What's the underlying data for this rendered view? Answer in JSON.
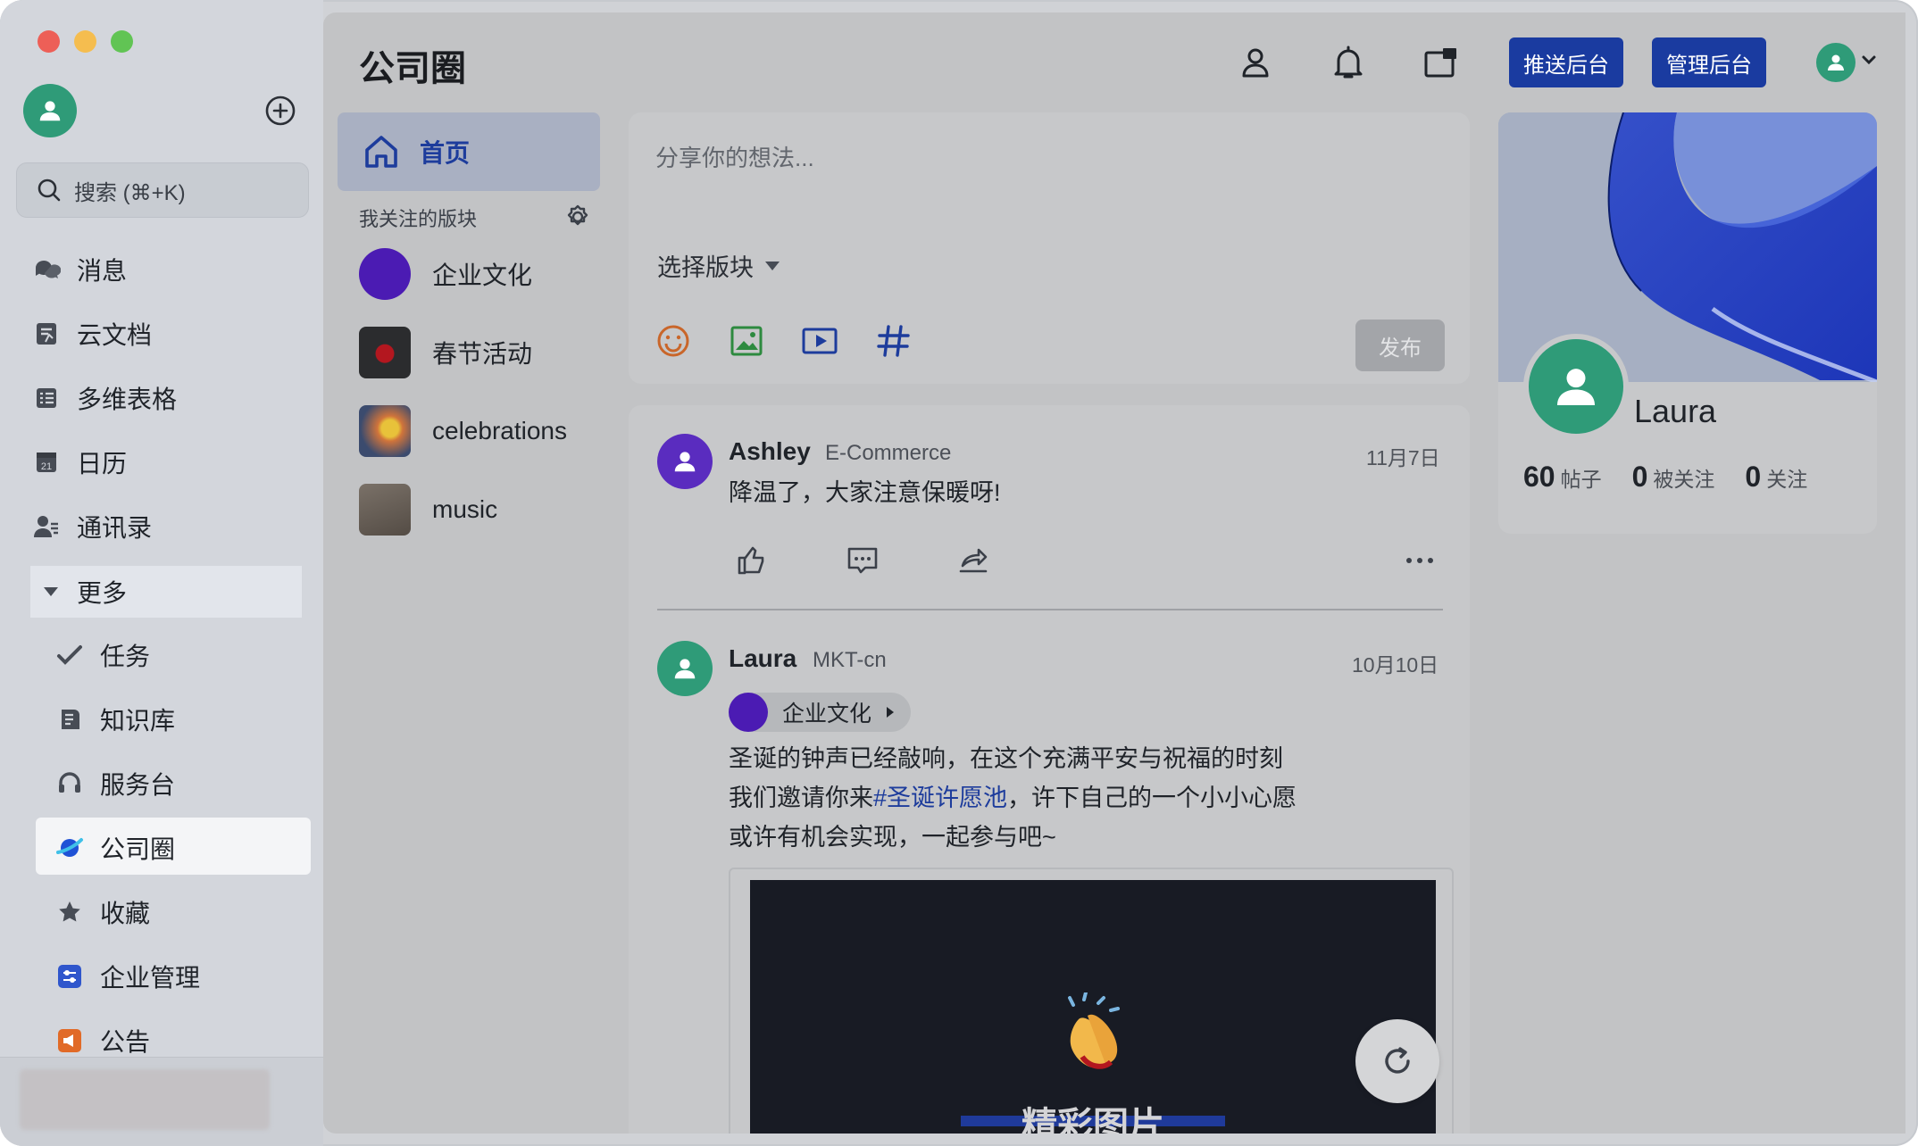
{
  "app": {
    "page_title": "公司圈"
  },
  "sidebar": {
    "search_placeholder": "搜索 (⌘+K)",
    "items": [
      {
        "label": "消息",
        "icon": "chat-bubbles-icon"
      },
      {
        "label": "云文档",
        "icon": "document-icon"
      },
      {
        "label": "多维表格",
        "icon": "table-icon"
      },
      {
        "label": "日历",
        "icon": "calendar-icon"
      },
      {
        "label": "通讯录",
        "icon": "contacts-icon"
      }
    ],
    "more_label": "更多",
    "sub_items": [
      {
        "label": "任务",
        "icon": "task-check-icon"
      },
      {
        "label": "知识库",
        "icon": "wiki-icon"
      },
      {
        "label": "服务台",
        "icon": "headset-icon"
      },
      {
        "label": "公司圈",
        "icon": "planet-icon"
      },
      {
        "label": "收藏",
        "icon": "star-icon"
      },
      {
        "label": "企业管理",
        "icon": "admin-sliders-icon"
      },
      {
        "label": "公告",
        "icon": "megaphone-icon"
      }
    ],
    "calendar_day": "21"
  },
  "header": {
    "push_button": "推送后台",
    "admin_button": "管理后台"
  },
  "boards": {
    "home_label": "首页",
    "followed_label": "我关注的版块",
    "items": [
      {
        "label": "企业文化"
      },
      {
        "label": "春节活动"
      },
      {
        "label": "celebrations"
      },
      {
        "label": "music"
      }
    ]
  },
  "composer": {
    "placeholder": "分享你的想法...",
    "select_label": "选择版块",
    "publish_label": "发布"
  },
  "posts": [
    {
      "author": "Ashley",
      "dept": "E-Commerce",
      "date": "11月7日",
      "text": "降温了，大家注意保暖呀!"
    },
    {
      "author": "Laura",
      "dept": "MKT-cn",
      "date": "10月10日",
      "board": "企业文化",
      "line1": "圣诞的钟声已经敲响，在这个充满平安与祝福的时刻",
      "line2_pre": "我们邀请你来",
      "line2_tag": "#圣诞许愿池",
      "line2_post": "，许下自己的一个小小心愿",
      "line3": "或许有机会实现，一起参与吧~",
      "media_title": "精彩图片"
    }
  ],
  "profile": {
    "name": "Laura",
    "posts_count": "60",
    "posts_label": "帖子",
    "followers_count": "0",
    "followers_label": "被关注",
    "following_count": "0",
    "following_label": "关注"
  },
  "colors": {
    "accent": "#1a3ba0",
    "avatar_green": "#2f9b78",
    "avatar_purple": "#5a2cbf",
    "hashtag": "#1d3c9c"
  }
}
